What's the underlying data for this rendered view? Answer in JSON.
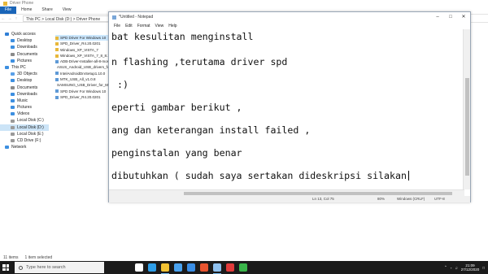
{
  "explorer": {
    "title": "Driver Phone",
    "ribbon_tabs": [
      "File",
      "Home",
      "Share",
      "View"
    ],
    "breadcrumb": "This PC > Local Disk (D:) > Driver Phone",
    "nav_items": [
      {
        "label": "Quick access",
        "level": 1,
        "color": "#2f7fd6"
      },
      {
        "label": "Desktop",
        "level": 2,
        "color": "#3d8fe0"
      },
      {
        "label": "Downloads",
        "level": 2,
        "color": "#3d8fe0"
      },
      {
        "label": "Documents",
        "level": 2,
        "color": "#8a8a8a"
      },
      {
        "label": "Pictures",
        "level": 2,
        "color": "#3d8fe0"
      },
      {
        "label": "This PC",
        "level": 1,
        "color": "#3d8fe0"
      },
      {
        "label": "3D Objects",
        "level": 2,
        "color": "#5aa0e8"
      },
      {
        "label": "Desktop",
        "level": 2,
        "color": "#3d8fe0"
      },
      {
        "label": "Documents",
        "level": 2,
        "color": "#8a8a8a"
      },
      {
        "label": "Downloads",
        "level": 2,
        "color": "#3d8fe0"
      },
      {
        "label": "Music",
        "level": 2,
        "color": "#3d8fe0"
      },
      {
        "label": "Pictures",
        "level": 2,
        "color": "#3d8fe0"
      },
      {
        "label": "Videos",
        "level": 2,
        "color": "#3d8fe0"
      },
      {
        "label": "Local Disk (C:)",
        "level": 2,
        "color": "#9a9a9a"
      },
      {
        "label": "Local Disk (D:)",
        "level": 2,
        "color": "#9a9a9a",
        "selected": true
      },
      {
        "label": "Local Disk (E:)",
        "level": 2,
        "color": "#9a9a9a"
      },
      {
        "label": "CD Drive (F:)",
        "level": 2,
        "color": "#9a9a9a"
      },
      {
        "label": "Network",
        "level": 1,
        "color": "#3d8fe0"
      }
    ],
    "files": [
      {
        "name": "SPD Driver For Windows 10",
        "type": "folder",
        "selected": true
      },
      {
        "name": "SPD_Driver_R4.20.0201",
        "type": "folder"
      },
      {
        "name": "Windows_XP_VISTA_7",
        "type": "folder"
      },
      {
        "name": "Windows_XP_VISTA_7_8_8.1",
        "type": "folder"
      },
      {
        "name": "ADB-Driver-Installer-all-8-most",
        "type": "app"
      },
      {
        "name": "ASUS_Android_USB_drivers_for_Windows",
        "type": "app"
      },
      {
        "name": "IntelAndroidDrvSetup1.10.0",
        "type": "app"
      },
      {
        "name": "MTK_USB_All_v1.0.8",
        "type": "app"
      },
      {
        "name": "SAMSUNG_USB_Driver_for_Mobile_Phones",
        "type": "app"
      },
      {
        "name": "SPD Driver For Windows 10",
        "type": "app"
      },
      {
        "name": "SPD_Driver_R4.20.0201",
        "type": "app"
      }
    ],
    "status_items": "11 items",
    "status_selected": "1 item selected"
  },
  "notepad": {
    "title": "*Untitled - Notepad",
    "menu": [
      "File",
      "Edit",
      "Format",
      "View",
      "Help"
    ],
    "lines": [
      "bat kesulitan menginstall",
      "n flashing ,terutama driver spd",
      " :)",
      "eperti gambar berikut ,",
      "ang dan keterangan install failed ,",
      "penginstalan yang benar",
      "dibutuhkan ( sudah saya sertakan dideskripsi silakan"
    ],
    "status": {
      "position": "Ln 13, Col 75",
      "zoom": "80%",
      "line_ending": "Windows (CRLF)",
      "encoding": "UTF-8"
    }
  },
  "taskbar": {
    "search_placeholder": "Type here to search",
    "time": "21:09",
    "date": "27/12/2020",
    "apps": [
      {
        "name": "task-view",
        "color": "#ffffff"
      },
      {
        "name": "edge",
        "color": "#2e9ee8"
      },
      {
        "name": "file-explorer",
        "color": "#f2c233",
        "active": true
      },
      {
        "name": "store",
        "color": "#4aa3f0"
      },
      {
        "name": "mail",
        "color": "#3a8ee6"
      },
      {
        "name": "office",
        "color": "#e8542f"
      },
      {
        "name": "notepad",
        "color": "#8fc1ef",
        "active": true
      },
      {
        "name": "recorder",
        "color": "#e23b3b"
      },
      {
        "name": "app",
        "color": "#3ab54a"
      }
    ]
  }
}
